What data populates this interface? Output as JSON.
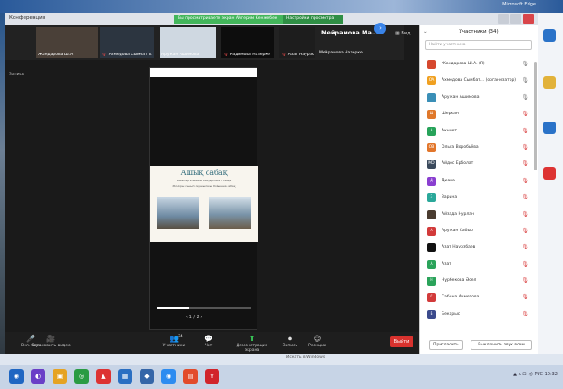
{
  "desktop": {
    "title": "Microsoft Edge"
  },
  "window": {
    "title": "Конференция",
    "banner": "Вы просматриваете экран Айгерим Кенжебек",
    "banner_action": "Настройки просмотра"
  },
  "gallery": {
    "tiles": [
      {
        "name": "Жандарова Ш.А.",
        "muted": false,
        "bg": "#4a4038"
      },
      {
        "name": "Ахмедова Сымбат Б...",
        "muted": true,
        "bg": "#2c3540"
      },
      {
        "name": "Аружан Ашимова",
        "muted": false,
        "bg": "#cfd8e1"
      },
      {
        "name": "Радимова Назерке",
        "muted": true,
        "bg": "#0d0d0d"
      },
      {
        "name": "Азат Наурзбаев",
        "muted": true,
        "bg": "#1d1d1d"
      },
      {
        "name": "Мейрамова Назерке",
        "muted": true,
        "bg": "#111111"
      }
    ],
    "active_speaker": "Мейрамова  Ма...",
    "view_label": "Вид"
  },
  "stage": {
    "side_label": "Запись",
    "slide_title": "Ашық сабақ",
    "slide_line1": "Бакыгерге шешім бағдарлама тілінде",
    "slide_line2": "Жоғары сынып оқушылары бойынша сабақ",
    "pager": "‹  1 / 2  ›"
  },
  "toolbar": {
    "items": [
      {
        "icon": "🎤",
        "label": "Вкл. звук",
        "green": false
      },
      {
        "icon": "🎥",
        "label": "Остановить видео",
        "green": false
      },
      {
        "icon": "👥",
        "label": "Участники",
        "green": false
      },
      {
        "icon": "💬",
        "label": "Чат",
        "green": false
      },
      {
        "icon": "⬆",
        "label": "Демонстрация экрана",
        "green": true
      },
      {
        "icon": "⏺",
        "label": "Запись",
        "green": false
      },
      {
        "icon": "☺",
        "label": "Реакции",
        "green": false
      }
    ],
    "participants_count": "34",
    "leave_label": "Выйти"
  },
  "panel": {
    "title": "Участники (34)",
    "search_placeholder": "Найти участника",
    "participants": [
      {
        "name": "Жандарова Ш.А. (Я)",
        "initials": "",
        "color": "#d6482e",
        "muted": false
      },
      {
        "name": "Ахмедова Сымбат... (организатор)",
        "initials": "ОА",
        "color": "#f0a020",
        "muted": false
      },
      {
        "name": "Аружан Ашимова",
        "initials": "",
        "color": "#3a8fb7",
        "muted": false
      },
      {
        "name": "Шерхан",
        "initials": "Ш",
        "color": "#e0782a",
        "muted": true
      },
      {
        "name": "Акниет",
        "initials": "А",
        "color": "#27a35a",
        "muted": true
      },
      {
        "name": "Ольга Воробьёва",
        "initials": "ОВ",
        "color": "#e2762b",
        "muted": true
      },
      {
        "name": "Айдос Ерболат",
        "initials": "МО",
        "color": "#3b4a5c",
        "muted": true
      },
      {
        "name": "Диана",
        "initials": "Д",
        "color": "#8a3fd0",
        "muted": true
      },
      {
        "name": "Зарина",
        "initials": "З",
        "color": "#2aa89a",
        "muted": true
      },
      {
        "name": "Айзада Нурлан",
        "initials": "",
        "color": "#4a3c30",
        "muted": true
      },
      {
        "name": "Аружан Сабыр",
        "initials": "А",
        "color": "#d23a3a",
        "muted": true
      },
      {
        "name": "Азат Наурзбаев",
        "initials": "",
        "color": "#111111",
        "muted": true
      },
      {
        "name": "Азат",
        "initials": "А",
        "color": "#2aa35a",
        "muted": true
      },
      {
        "name": "Нұрбекова Әсел",
        "initials": "Н",
        "color": "#2aa35a",
        "muted": true
      },
      {
        "name": "Сабина Ахметова",
        "initials": "С",
        "color": "#d23a3a",
        "muted": true
      },
      {
        "name": "Бекарыс",
        "initials": "Б",
        "color": "#3b4a8c",
        "muted": true
      }
    ],
    "invite_label": "Пригласить",
    "mute_all_label": "Выключить звук всем"
  },
  "dock": {
    "hint": "Искать в Windows"
  },
  "taskbar": {
    "apps": [
      {
        "icon": "◉",
        "color": "#1f66c2"
      },
      {
        "icon": "◐",
        "color": "#6a3fc7"
      },
      {
        "icon": "▣",
        "color": "#e5a323"
      },
      {
        "icon": "◎",
        "color": "#2a9b43"
      },
      {
        "icon": "▲",
        "color": "#d33"
      },
      {
        "icon": "▦",
        "color": "#2a6fc2"
      },
      {
        "icon": "◆",
        "color": "#3566a8"
      },
      {
        "icon": "◉",
        "color": "#2d8cf0"
      },
      {
        "icon": "▤",
        "color": "#e24b2b"
      },
      {
        "icon": "Y",
        "color": "#d1242a"
      }
    ],
    "tray": "▲  ⌂  ⊡  ◁)  РУС  10:32"
  }
}
